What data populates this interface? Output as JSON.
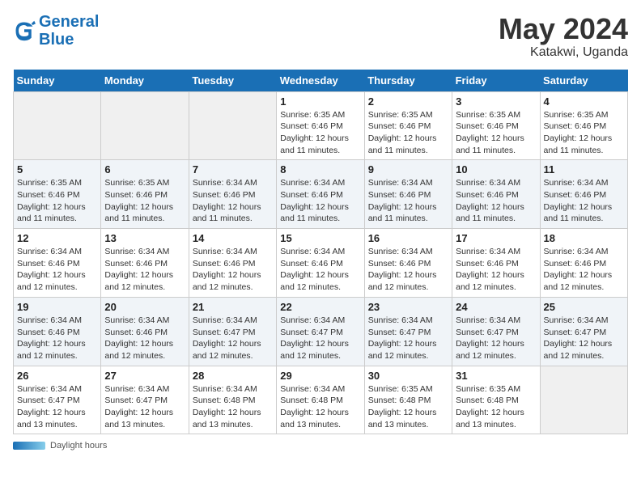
{
  "header": {
    "logo_general": "General",
    "logo_blue": "Blue",
    "title": "May 2024",
    "subtitle": "Katakwi, Uganda"
  },
  "footer": {
    "label": "Daylight hours"
  },
  "days_of_week": [
    "Sunday",
    "Monday",
    "Tuesday",
    "Wednesday",
    "Thursday",
    "Friday",
    "Saturday"
  ],
  "weeks": [
    {
      "days": [
        {
          "num": "",
          "info": ""
        },
        {
          "num": "",
          "info": ""
        },
        {
          "num": "",
          "info": ""
        },
        {
          "num": "1",
          "info": "Sunrise: 6:35 AM\nSunset: 6:46 PM\nDaylight: 12 hours\nand 11 minutes."
        },
        {
          "num": "2",
          "info": "Sunrise: 6:35 AM\nSunset: 6:46 PM\nDaylight: 12 hours\nand 11 minutes."
        },
        {
          "num": "3",
          "info": "Sunrise: 6:35 AM\nSunset: 6:46 PM\nDaylight: 12 hours\nand 11 minutes."
        },
        {
          "num": "4",
          "info": "Sunrise: 6:35 AM\nSunset: 6:46 PM\nDaylight: 12 hours\nand 11 minutes."
        }
      ]
    },
    {
      "days": [
        {
          "num": "5",
          "info": "Sunrise: 6:35 AM\nSunset: 6:46 PM\nDaylight: 12 hours\nand 11 minutes."
        },
        {
          "num": "6",
          "info": "Sunrise: 6:35 AM\nSunset: 6:46 PM\nDaylight: 12 hours\nand 11 minutes."
        },
        {
          "num": "7",
          "info": "Sunrise: 6:34 AM\nSunset: 6:46 PM\nDaylight: 12 hours\nand 11 minutes."
        },
        {
          "num": "8",
          "info": "Sunrise: 6:34 AM\nSunset: 6:46 PM\nDaylight: 12 hours\nand 11 minutes."
        },
        {
          "num": "9",
          "info": "Sunrise: 6:34 AM\nSunset: 6:46 PM\nDaylight: 12 hours\nand 11 minutes."
        },
        {
          "num": "10",
          "info": "Sunrise: 6:34 AM\nSunset: 6:46 PM\nDaylight: 12 hours\nand 11 minutes."
        },
        {
          "num": "11",
          "info": "Sunrise: 6:34 AM\nSunset: 6:46 PM\nDaylight: 12 hours\nand 11 minutes."
        }
      ]
    },
    {
      "days": [
        {
          "num": "12",
          "info": "Sunrise: 6:34 AM\nSunset: 6:46 PM\nDaylight: 12 hours\nand 12 minutes."
        },
        {
          "num": "13",
          "info": "Sunrise: 6:34 AM\nSunset: 6:46 PM\nDaylight: 12 hours\nand 12 minutes."
        },
        {
          "num": "14",
          "info": "Sunrise: 6:34 AM\nSunset: 6:46 PM\nDaylight: 12 hours\nand 12 minutes."
        },
        {
          "num": "15",
          "info": "Sunrise: 6:34 AM\nSunset: 6:46 PM\nDaylight: 12 hours\nand 12 minutes."
        },
        {
          "num": "16",
          "info": "Sunrise: 6:34 AM\nSunset: 6:46 PM\nDaylight: 12 hours\nand 12 minutes."
        },
        {
          "num": "17",
          "info": "Sunrise: 6:34 AM\nSunset: 6:46 PM\nDaylight: 12 hours\nand 12 minutes."
        },
        {
          "num": "18",
          "info": "Sunrise: 6:34 AM\nSunset: 6:46 PM\nDaylight: 12 hours\nand 12 minutes."
        }
      ]
    },
    {
      "days": [
        {
          "num": "19",
          "info": "Sunrise: 6:34 AM\nSunset: 6:46 PM\nDaylight: 12 hours\nand 12 minutes."
        },
        {
          "num": "20",
          "info": "Sunrise: 6:34 AM\nSunset: 6:46 PM\nDaylight: 12 hours\nand 12 minutes."
        },
        {
          "num": "21",
          "info": "Sunrise: 6:34 AM\nSunset: 6:47 PM\nDaylight: 12 hours\nand 12 minutes."
        },
        {
          "num": "22",
          "info": "Sunrise: 6:34 AM\nSunset: 6:47 PM\nDaylight: 12 hours\nand 12 minutes."
        },
        {
          "num": "23",
          "info": "Sunrise: 6:34 AM\nSunset: 6:47 PM\nDaylight: 12 hours\nand 12 minutes."
        },
        {
          "num": "24",
          "info": "Sunrise: 6:34 AM\nSunset: 6:47 PM\nDaylight: 12 hours\nand 12 minutes."
        },
        {
          "num": "25",
          "info": "Sunrise: 6:34 AM\nSunset: 6:47 PM\nDaylight: 12 hours\nand 12 minutes."
        }
      ]
    },
    {
      "days": [
        {
          "num": "26",
          "info": "Sunrise: 6:34 AM\nSunset: 6:47 PM\nDaylight: 12 hours\nand 13 minutes."
        },
        {
          "num": "27",
          "info": "Sunrise: 6:34 AM\nSunset: 6:47 PM\nDaylight: 12 hours\nand 13 minutes."
        },
        {
          "num": "28",
          "info": "Sunrise: 6:34 AM\nSunset: 6:48 PM\nDaylight: 12 hours\nand 13 minutes."
        },
        {
          "num": "29",
          "info": "Sunrise: 6:34 AM\nSunset: 6:48 PM\nDaylight: 12 hours\nand 13 minutes."
        },
        {
          "num": "30",
          "info": "Sunrise: 6:35 AM\nSunset: 6:48 PM\nDaylight: 12 hours\nand 13 minutes."
        },
        {
          "num": "31",
          "info": "Sunrise: 6:35 AM\nSunset: 6:48 PM\nDaylight: 12 hours\nand 13 minutes."
        },
        {
          "num": "",
          "info": ""
        }
      ]
    }
  ]
}
